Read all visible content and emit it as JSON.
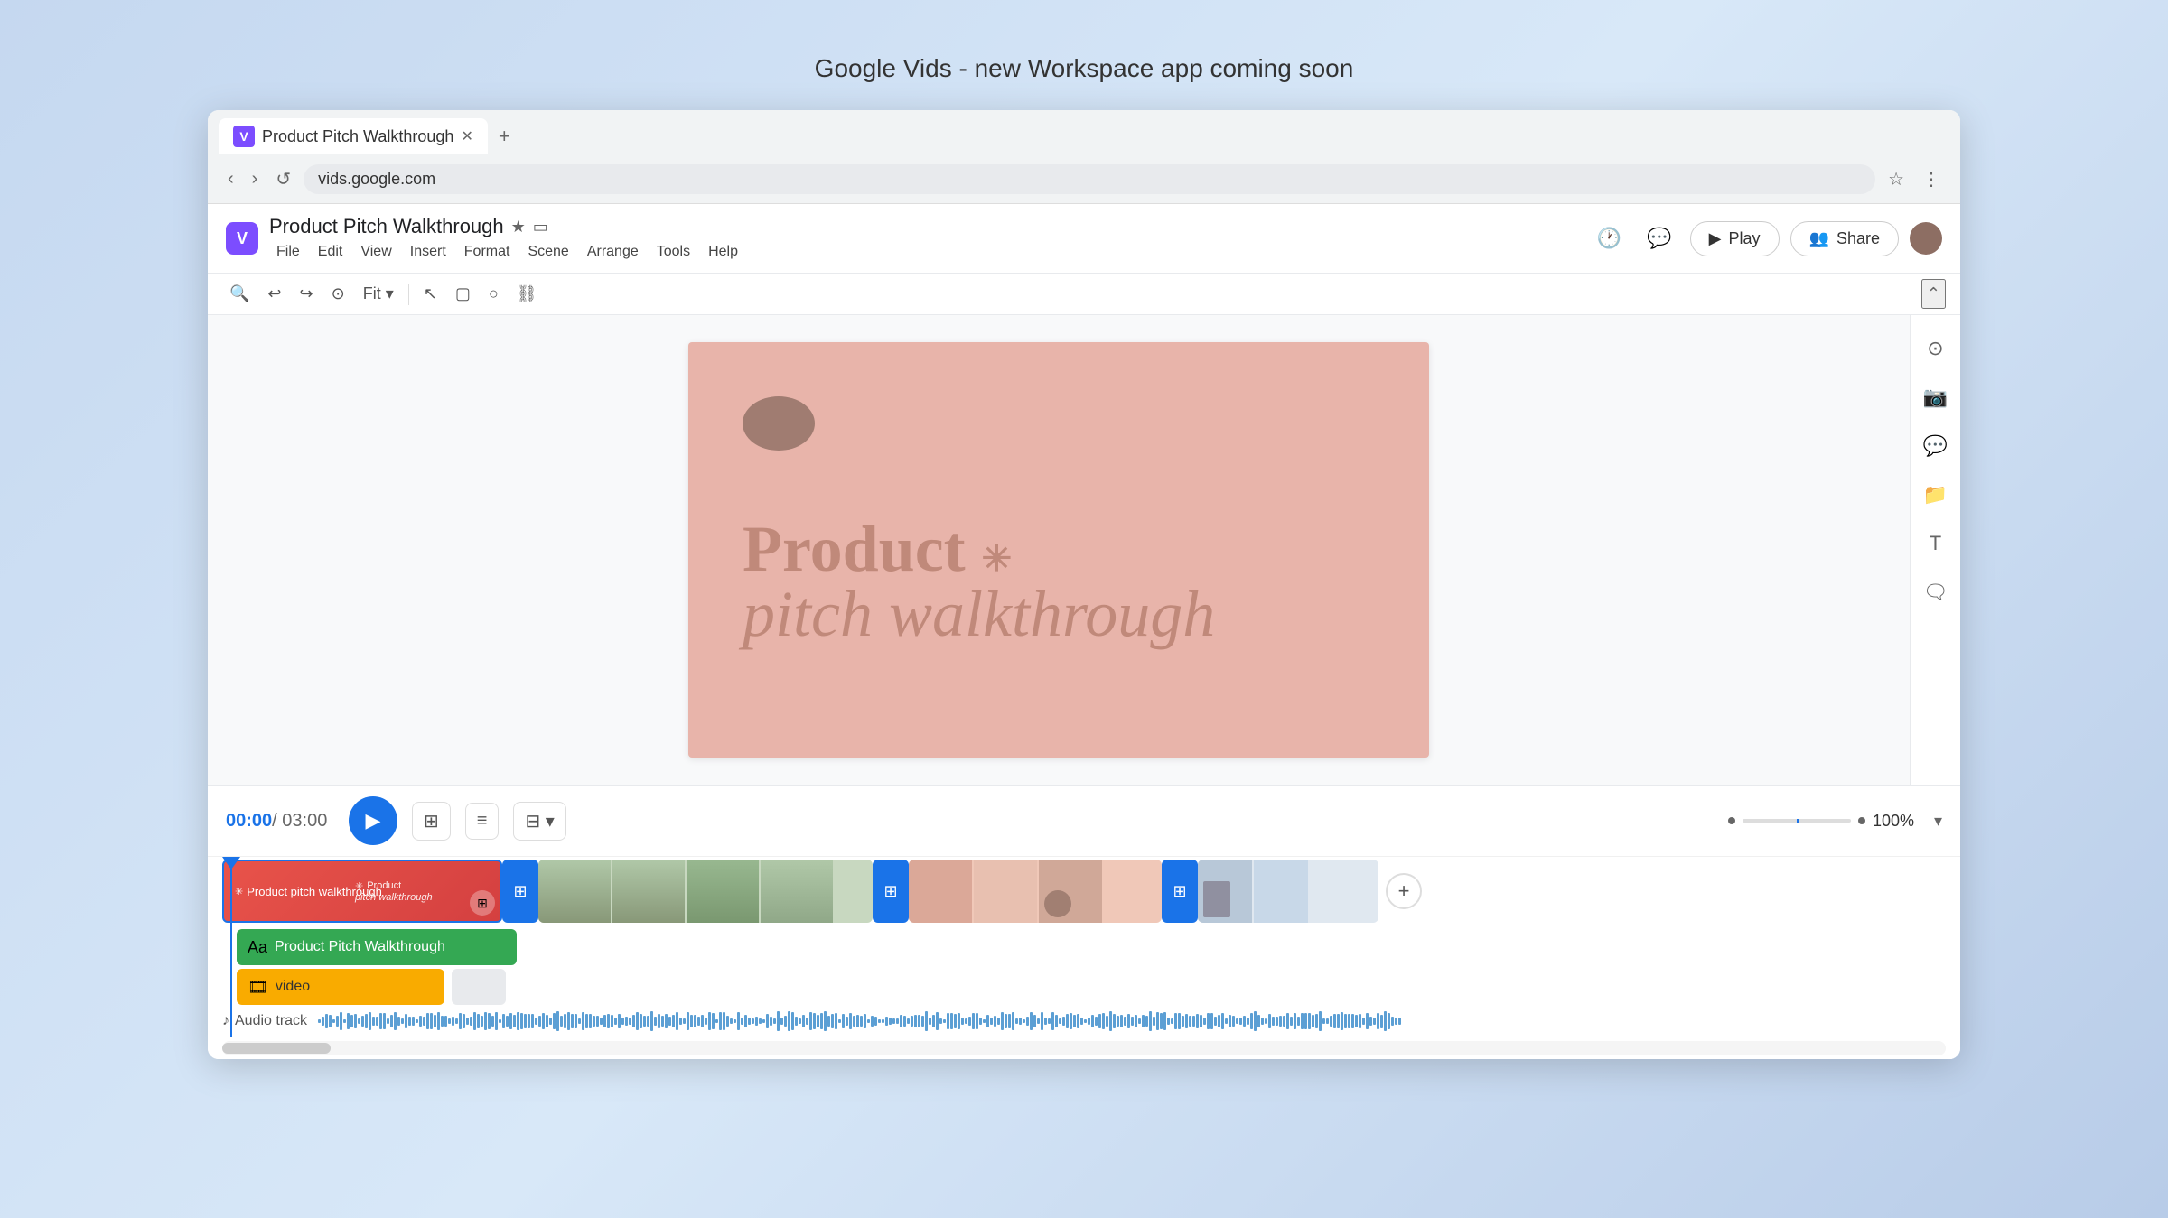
{
  "page": {
    "header_text": "Google Vids - new Workspace app coming soon",
    "browser": {
      "tab_title": "Product Pitch Walkthrough",
      "tab_favicon": "V",
      "url": "vids.google.com",
      "new_tab_label": "+"
    },
    "app": {
      "logo_letter": "V",
      "title": "Product Pitch Walkthrough",
      "star_icon": "★",
      "camera_icon": "📷",
      "menu_items": [
        "File",
        "Edit",
        "View",
        "Insert",
        "Format",
        "Scene",
        "Arrange",
        "Tools",
        "Help"
      ],
      "history_icon": "🕐",
      "comment_icon": "💬",
      "play_button_label": "Play",
      "share_button_label": "Share"
    },
    "toolbar": {
      "zoom_in": "🔍",
      "undo": "↩",
      "redo": "↪",
      "zoom_out": "🔍",
      "fit_label": "Fit",
      "select": "↖",
      "frame": "▢",
      "circle": "○",
      "link": "🔗"
    },
    "slide": {
      "title_line1": "Product ✳",
      "title_line2": "pitch walkthrough"
    },
    "right_sidebar_icons": [
      "⊙",
      "📷",
      "💬",
      "📁",
      "T",
      "💬"
    ],
    "timeline": {
      "current_time": "00:00",
      "total_time": "/ 03:00",
      "zoom_percent": "100%",
      "segments": [
        {
          "type": "red",
          "label": "Product pitch walkthrough",
          "sublabel": "pitch walkthrough"
        },
        {
          "type": "video",
          "frames": 5
        },
        {
          "type": "pink",
          "frames": 4
        },
        {
          "type": "last",
          "frames": 3
        }
      ],
      "green_track_label": "Product Pitch Walkthrough",
      "yellow_track_label": "video",
      "audio_track_label": "Audio track"
    }
  }
}
